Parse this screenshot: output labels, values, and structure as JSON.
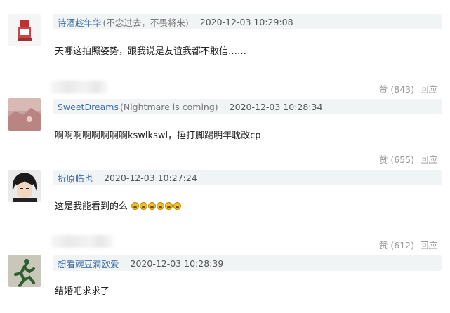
{
  "comments": [
    {
      "username": "诗酒趁年华",
      "motto": "(不念过去，不畏将来)",
      "time": "2020-12-03 10:29:08",
      "content": "天哪这拍照姿势，跟我说是友谊我都不敢信……",
      "likes": "赞 (843)",
      "reply": "回应",
      "avatar_icon": "figure-on-white-avatar"
    },
    {
      "username": "SweetDreams",
      "motto": "(Nightmare is coming)",
      "time": "2020-12-03 10:28:34",
      "content": "啊啊啊啊啊啊啊啊kswlkswl，捶打脚踢明年耽改cp",
      "likes": "赞 (655)",
      "reply": "回应",
      "avatar_icon": "pink-landscape-avatar"
    },
    {
      "username": "折原临也",
      "motto": "",
      "time": "2020-12-03 10:27:24",
      "content": "这是我能看到的么",
      "emoji_count": 6,
      "likes": "赞 (612)",
      "reply": "回应",
      "avatar_icon": "anime-boy-avatar"
    },
    {
      "username": "想看豌豆滴欧爱",
      "motto": "",
      "time": "2020-12-03 10:28:39",
      "content": "结婚吧求求了",
      "avatar_icon": "running-man-sign-avatar"
    }
  ]
}
